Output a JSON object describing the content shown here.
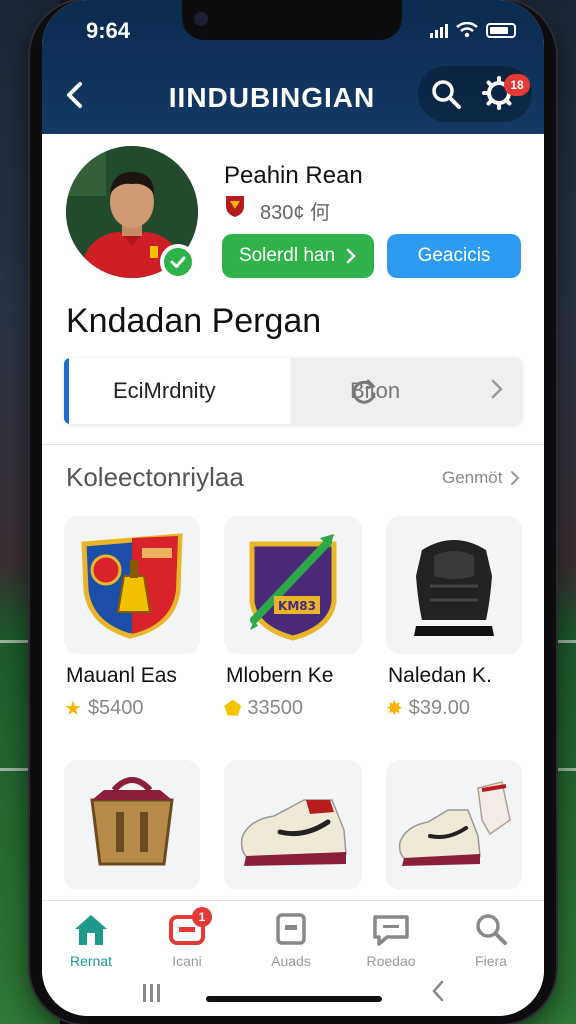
{
  "status_bar": {
    "time": "9:64"
  },
  "header": {
    "back_icon": "chevron-left-icon",
    "title": "IINDUBINGIAN",
    "search_icon": "search-icon",
    "settings_icon": "gear-icon",
    "settings_badge": "18",
    "colors": {
      "header_bg": "#0b2a4e",
      "badge": "#e53935"
    }
  },
  "profile": {
    "name": "Peahin Rean",
    "stats_text": "830¢ 何",
    "verified": true,
    "primary_button": "Solerdl han",
    "secondary_button": "Geacicis",
    "colors": {
      "primary": "#2fb24a",
      "secondary": "#2d9cf0"
    }
  },
  "page_title": "Kndadan Pergan",
  "segment": {
    "left_label": "EciMrdnity",
    "right_label": "Biton",
    "active": "left"
  },
  "collection": {
    "title": "Koleectonriylaa",
    "see_all": "Genmöt",
    "items": [
      {
        "name": "Mauanl Eas",
        "price": "$5400",
        "icon": "shield-crest"
      },
      {
        "name": "Mlobern Ke",
        "price": "33500",
        "icon": "emblem-badge"
      },
      {
        "name": "Naledan K.",
        "price": "$39.00",
        "icon": "chest-protector"
      },
      {
        "name": "",
        "price": "",
        "icon": "bag"
      },
      {
        "name": "",
        "price": "",
        "icon": "sneaker"
      },
      {
        "name": "",
        "price": "",
        "icon": "sneaker-gloves"
      }
    ]
  },
  "tabbar": {
    "tabs": [
      {
        "label": "Rernat",
        "icon": "home-icon",
        "active": true
      },
      {
        "label": "Icani",
        "icon": "inbox-icon",
        "badge": "1"
      },
      {
        "label": "Auads",
        "icon": "square-icon"
      },
      {
        "label": "Roedao",
        "icon": "chat-icon"
      },
      {
        "label": "Fiera",
        "icon": "search-icon"
      }
    ],
    "active_color": "#1d9a8c"
  }
}
